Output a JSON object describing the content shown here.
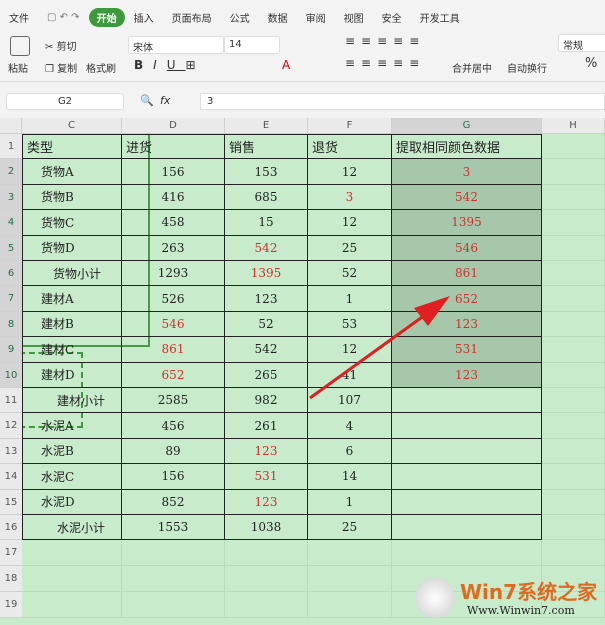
{
  "menu": {
    "items": [
      "文件",
      "开始",
      "插入",
      "页面布局",
      "公式",
      "数据",
      "审阅",
      "视图",
      "安全",
      "开发工具"
    ],
    "active": "开始"
  },
  "ribbon": {
    "paste": "粘贴",
    "cut": "剪切",
    "copy": "复制",
    "format_painter": "格式刷",
    "font": "宋体",
    "size": "14",
    "merge": "合并居中",
    "wrap": "自动换行",
    "number_format": "常规",
    "percent": "%"
  },
  "formula": {
    "name_box": "G2",
    "fx": "fx",
    "value": "3"
  },
  "columns": [
    "C",
    "D",
    "E",
    "F",
    "G",
    "H"
  ],
  "rows": [
    {
      "n": "1",
      "c": "类型",
      "d": "进货",
      "e": "销售",
      "f": "退货",
      "g": "提取相同颜色数据"
    },
    {
      "n": "2",
      "c": "货物A",
      "d": "156",
      "e": "153",
      "f": "12",
      "g": "3"
    },
    {
      "n": "3",
      "c": "货物B",
      "d": "416",
      "e": "685",
      "f": "3",
      "g": "542"
    },
    {
      "n": "4",
      "c": "货物C",
      "d": "458",
      "e": "15",
      "f": "12",
      "g": "1395"
    },
    {
      "n": "5",
      "c": "货物D",
      "d": "263",
      "e": "542",
      "f": "25",
      "g": "546"
    },
    {
      "n": "6",
      "c": "货物小计",
      "d": "1293",
      "e": "1395",
      "f": "52",
      "g": "861"
    },
    {
      "n": "7",
      "c": "建材A",
      "d": "526",
      "e": "123",
      "f": "1",
      "g": "652"
    },
    {
      "n": "8",
      "c": "建材B",
      "d": "546",
      "e": "52",
      "f": "53",
      "g": "123"
    },
    {
      "n": "9",
      "c": "建材C",
      "d": "861",
      "e": "542",
      "f": "12",
      "g": "531"
    },
    {
      "n": "10",
      "c": "建材D",
      "d": "652",
      "e": "265",
      "f": "41",
      "g": "123"
    },
    {
      "n": "11",
      "c": "建材小计",
      "d": "2585",
      "e": "982",
      "f": "107",
      "g": ""
    },
    {
      "n": "12",
      "c": "水泥A",
      "d": "456",
      "e": "261",
      "f": "4",
      "g": ""
    },
    {
      "n": "13",
      "c": "水泥B",
      "d": "89",
      "e": "123",
      "f": "6",
      "g": ""
    },
    {
      "n": "14",
      "c": "水泥C",
      "d": "156",
      "e": "531",
      "f": "14",
      "g": ""
    },
    {
      "n": "15",
      "c": "水泥D",
      "d": "852",
      "e": "123",
      "f": "1",
      "g": ""
    },
    {
      "n": "16",
      "c": "水泥小计",
      "d": "1553",
      "e": "1038",
      "f": "25",
      "g": ""
    }
  ],
  "empty_rows": [
    "17",
    "18",
    "19"
  ],
  "red_cells": [
    "3f",
    "5e",
    "6e",
    "8d",
    "9d",
    "10d",
    "13e",
    "14e",
    "15e"
  ],
  "watermark": {
    "title": "Win7系统之家",
    "url": "Www.Winwin7.com"
  }
}
